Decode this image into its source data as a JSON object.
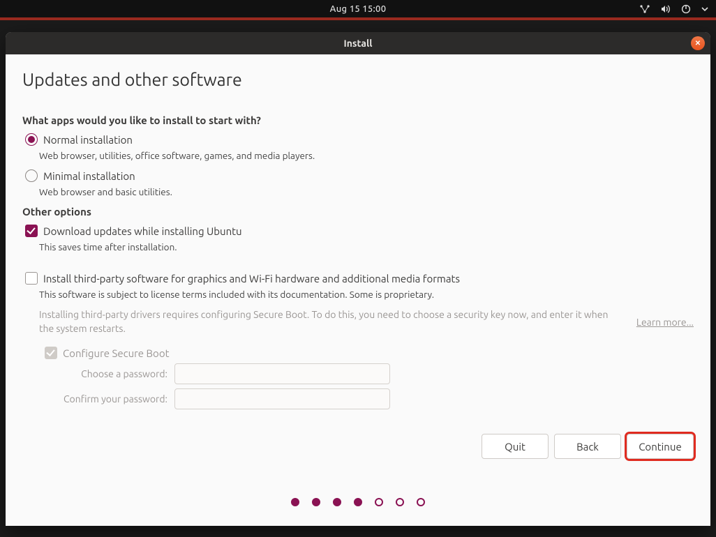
{
  "topbar": {
    "clock": "Aug 15  15:00"
  },
  "window": {
    "title": "Install",
    "close_icon": "close-icon"
  },
  "page": {
    "heading": "Updates and other software",
    "question": "What apps would you like to install to start with?",
    "options": {
      "normal": {
        "label": "Normal installation",
        "hint": "Web browser, utilities, office software, games, and media players.",
        "selected": true
      },
      "minimal": {
        "label": "Minimal installation",
        "hint": "Web browser and basic utilities.",
        "selected": false
      }
    },
    "other_options_title": "Other options",
    "download_updates": {
      "label": "Download updates while installing Ubuntu",
      "hint": "This saves time after installation.",
      "checked": true
    },
    "third_party": {
      "label": "Install third-party software for graphics and Wi-Fi hardware and additional media formats",
      "hint": "This software is subject to license terms included with its documentation. Some is proprietary.",
      "checked": false
    },
    "secure_boot": {
      "info": "Installing third-party drivers requires configuring Secure Boot. To do this, you need to choose a security key now, and enter it when the system restarts.",
      "learn_more": "Learn more...",
      "config_label": "Configure Secure Boot",
      "choose_password_label": "Choose a password:",
      "confirm_password_label": "Confirm your password:"
    },
    "buttons": {
      "quit": "Quit",
      "back": "Back",
      "continue": "Continue"
    },
    "progress": {
      "current_step": 4,
      "total_steps": 7
    }
  }
}
